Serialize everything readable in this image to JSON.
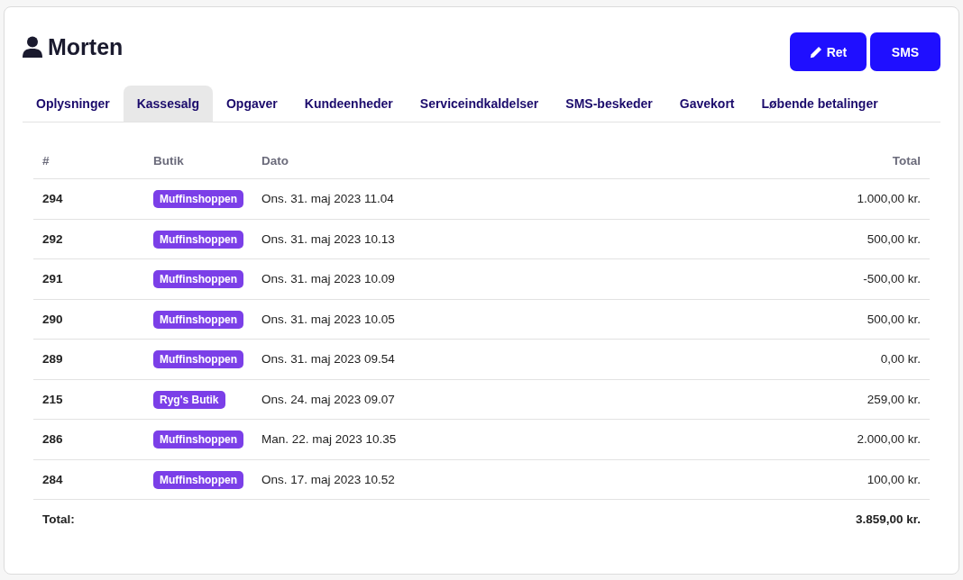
{
  "header": {
    "name": "Morten"
  },
  "buttons": [
    {
      "label": "Ret",
      "kind": "edit"
    },
    {
      "label": "SMS",
      "kind": "plain"
    }
  ],
  "tabs": [
    {
      "label": "Oplysninger",
      "selected": false
    },
    {
      "label": "Kassesalg",
      "selected": true
    },
    {
      "label": "Opgaver",
      "selected": false
    },
    {
      "label": "Kundeenheder",
      "selected": false
    },
    {
      "label": "Serviceindkaldelser",
      "selected": false
    },
    {
      "label": "SMS-beskeder",
      "selected": false
    },
    {
      "label": "Gavekort",
      "selected": false
    },
    {
      "label": "Løbende betalinger",
      "selected": false
    }
  ],
  "table": {
    "columns": [
      "#",
      "Butik",
      "Dato",
      "Total"
    ],
    "rows": [
      {
        "number": "294",
        "shop": "Muffinshoppen",
        "date": "Ons. 31. maj 2023 11.04",
        "total": "1.000,00 kr."
      },
      {
        "number": "292",
        "shop": "Muffinshoppen",
        "date": "Ons. 31. maj 2023 10.13",
        "total": "500,00 kr."
      },
      {
        "number": "291",
        "shop": "Muffinshoppen",
        "date": "Ons. 31. maj 2023 10.09",
        "total": "-500,00 kr."
      },
      {
        "number": "290",
        "shop": "Muffinshoppen",
        "date": "Ons. 31. maj 2023 10.05",
        "total": "500,00 kr."
      },
      {
        "number": "289",
        "shop": "Muffinshoppen",
        "date": "Ons. 31. maj 2023 09.54",
        "total": "0,00 kr."
      },
      {
        "number": "215",
        "shop": "Ryg's Butik",
        "date": "Ons. 24. maj 2023 09.07",
        "total": "259,00 kr."
      },
      {
        "number": "286",
        "shop": "Muffinshoppen",
        "date": "Man. 22. maj 2023 10.35",
        "total": "2.000,00 kr."
      },
      {
        "number": "284",
        "shop": "Muffinshoppen",
        "date": "Ons. 17. maj 2023 10.52",
        "total": "100,00 kr."
      }
    ],
    "footer": {
      "label": "Total:",
      "total": "3.859,00 kr."
    }
  }
}
